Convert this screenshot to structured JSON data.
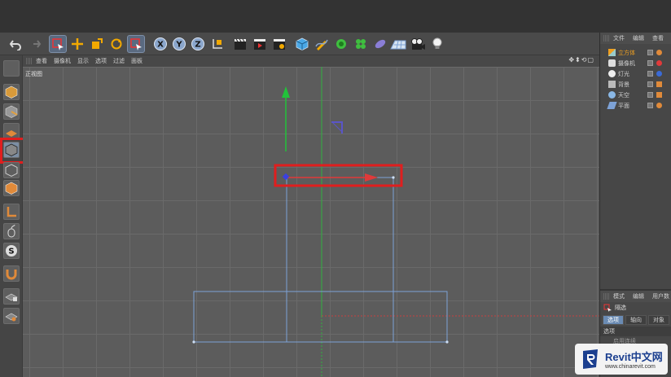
{
  "viewport": {
    "menu": [
      "查看",
      "摄像机",
      "显示",
      "选项",
      "过滤",
      "面板"
    ],
    "view_label": "正视图",
    "nav_icons": "✥⬍⟲▢"
  },
  "object_manager": {
    "menu": [
      "文件",
      "编辑",
      "查看"
    ],
    "objects": [
      {
        "name": "立方体",
        "color": "#f0a020",
        "icon": "cube-object-icon"
      },
      {
        "name": "摄像机",
        "color": "#cfcfcf",
        "icon": "camera-object-icon"
      },
      {
        "name": "灯光",
        "color": "#cfcfcf",
        "icon": "light-object-icon"
      },
      {
        "name": "背景",
        "color": "#cfcfcf",
        "icon": "background-object-icon"
      },
      {
        "name": "天空",
        "color": "#cfcfcf",
        "icon": "sky-object-icon"
      },
      {
        "name": "平面",
        "color": "#cfcfcf",
        "icon": "plane-object-icon"
      }
    ]
  },
  "attributes": {
    "menu": [
      "模式",
      "编辑",
      "用户数"
    ],
    "mode_label": "隔选",
    "tabs": [
      "选项",
      "轴向",
      "对象"
    ],
    "section": "选项",
    "sub": "启用连续"
  },
  "watermark": {
    "title": "Revit中文网",
    "url": "www.chinarevit.com"
  },
  "colors": {
    "highlight": "#e01e1e",
    "y_axis": "#22c23a",
    "x_axis": "#e03a3a",
    "selection": "#7da2d6",
    "accent": "#6a8bb3"
  }
}
